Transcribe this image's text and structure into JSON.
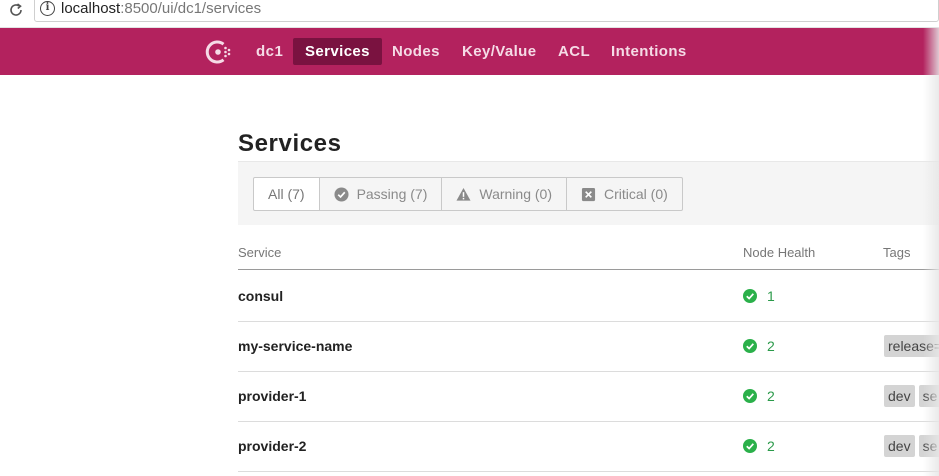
{
  "browser": {
    "url_host": "localhost",
    "url_rest": ":8500/ui/dc1/services"
  },
  "nav": {
    "datacenter": "dc1",
    "items": [
      {
        "label": "Services",
        "active": true
      },
      {
        "label": "Nodes",
        "active": false
      },
      {
        "label": "Key/Value",
        "active": false
      },
      {
        "label": "ACL",
        "active": false
      },
      {
        "label": "Intentions",
        "active": false
      }
    ],
    "brand_color": "#b3225e",
    "active_color": "#7a1240"
  },
  "page": {
    "title": "Services"
  },
  "filters": [
    {
      "label": "All (7)",
      "icon": "",
      "active": true
    },
    {
      "label": "Passing (7)",
      "icon": "check-circle-icon",
      "active": false
    },
    {
      "label": "Warning (0)",
      "icon": "warning-triangle-icon",
      "active": false
    },
    {
      "label": "Critical (0)",
      "icon": "critical-x-icon",
      "active": false
    }
  ],
  "table": {
    "columns": [
      "Service",
      "Node Health",
      "Tags"
    ],
    "rows": [
      {
        "name": "consul",
        "health": "1",
        "tags": []
      },
      {
        "name": "my-service-name",
        "health": "2",
        "tags": [
          "release="
        ]
      },
      {
        "name": "provider-1",
        "health": "2",
        "tags": [
          "dev",
          "se"
        ]
      },
      {
        "name": "provider-2",
        "health": "2",
        "tags": [
          "dev",
          "se"
        ]
      }
    ]
  },
  "colors": {
    "passing": "#2bb04a"
  }
}
